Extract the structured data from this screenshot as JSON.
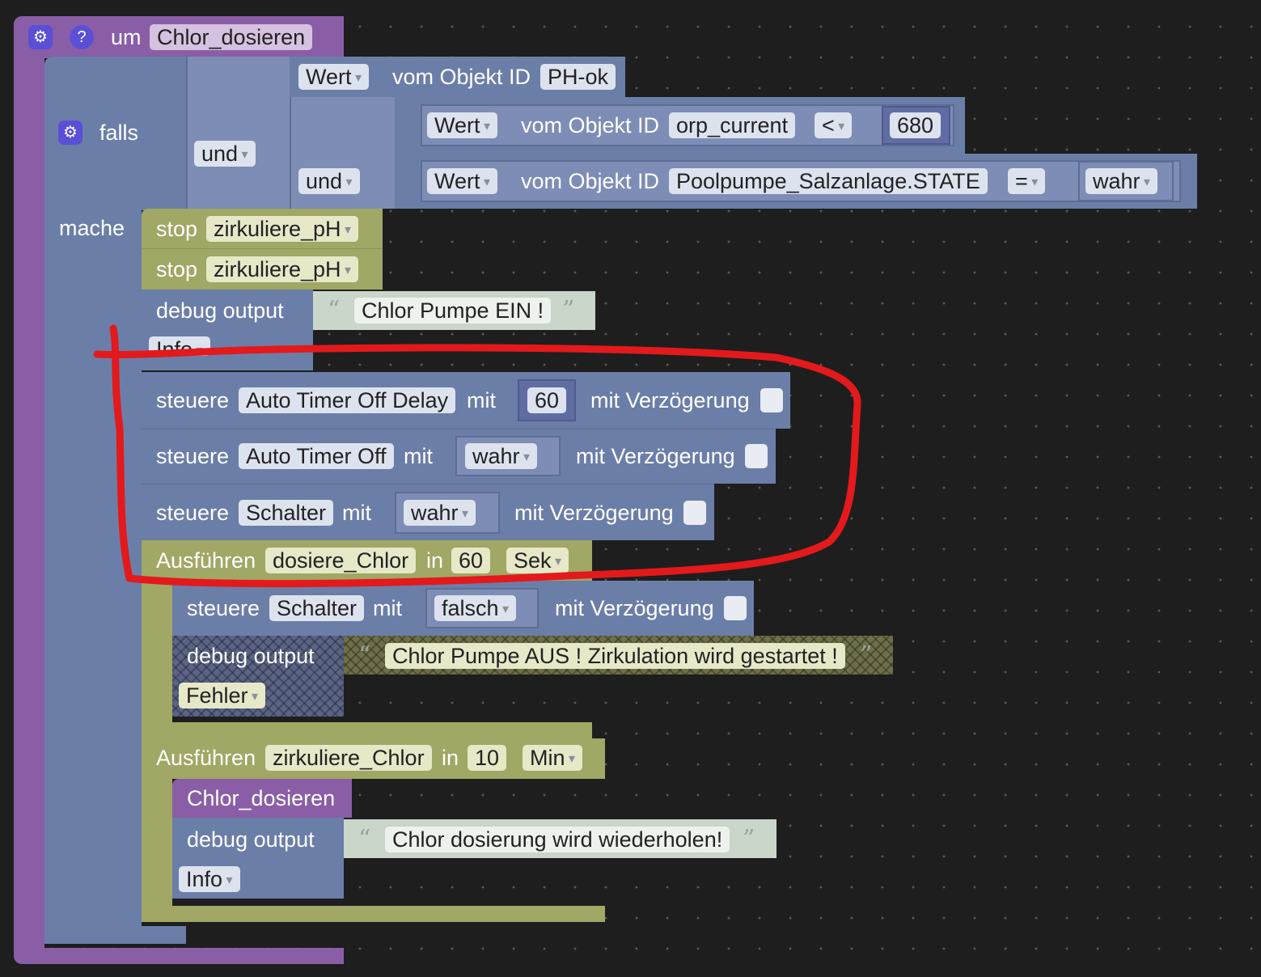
{
  "function_block": {
    "keyword": "um",
    "name": "Chlor_dosieren",
    "gear_icon": "gear-icon",
    "help_icon": "question-icon",
    "help_glyph": "?"
  },
  "if_block": {
    "falls": "falls",
    "mache": "mache",
    "und1": "und",
    "und2": "und"
  },
  "conditions": [
    {
      "prop": "Wert",
      "from": "vom Objekt ID",
      "object": "PH-ok"
    },
    {
      "prop": "Wert",
      "from": "vom Objekt ID",
      "object": "orp_current",
      "operator": "<",
      "value": "680"
    },
    {
      "prop": "Wert",
      "from": "vom Objekt ID",
      "object": "Poolpumpe_Salzanlage.STATE",
      "operator": "=",
      "value": "wahr"
    }
  ],
  "stops": [
    {
      "label": "stop",
      "target": "zirkuliere_pH"
    },
    {
      "label": "stop",
      "target": "zirkuliere_pH"
    }
  ],
  "debug1": {
    "label": "debug output",
    "text": "Chlor Pumpe EIN !",
    "level": "Info"
  },
  "controls": [
    {
      "label": "steuere",
      "target": "Auto Timer Off Delay",
      "with": "mit",
      "value": "60",
      "delay": "mit Verzögerung"
    },
    {
      "label": "steuere",
      "target": "Auto Timer Off",
      "with": "mit",
      "value": "wahr",
      "delay": "mit Verzögerung"
    },
    {
      "label": "steuere",
      "target": "Schalter",
      "with": "mit",
      "value": "wahr",
      "delay": "mit Verzögerung"
    }
  ],
  "exec1": {
    "label": "Ausführen",
    "name": "dosiere_Chlor",
    "in": "in",
    "amount": "60",
    "unit": "Sek",
    "control": {
      "label": "steuere",
      "target": "Schalter",
      "with": "mit",
      "value": "falsch",
      "delay": "mit Verzögerung"
    },
    "debug": {
      "label": "debug output",
      "text": "Chlor Pumpe AUS ! Zirkulation wird gestartet !",
      "level": "Fehler"
    }
  },
  "exec2": {
    "label": "Ausführen",
    "name": "zirkuliere_Chlor",
    "in": "in",
    "amount": "10",
    "unit": "Min",
    "call": "Chlor_dosieren",
    "debug": {
      "label": "debug output",
      "text": "Chlor dosierung wird wiederholen!",
      "level": "Info"
    }
  },
  "annotation": {
    "color": "#e3191c"
  }
}
